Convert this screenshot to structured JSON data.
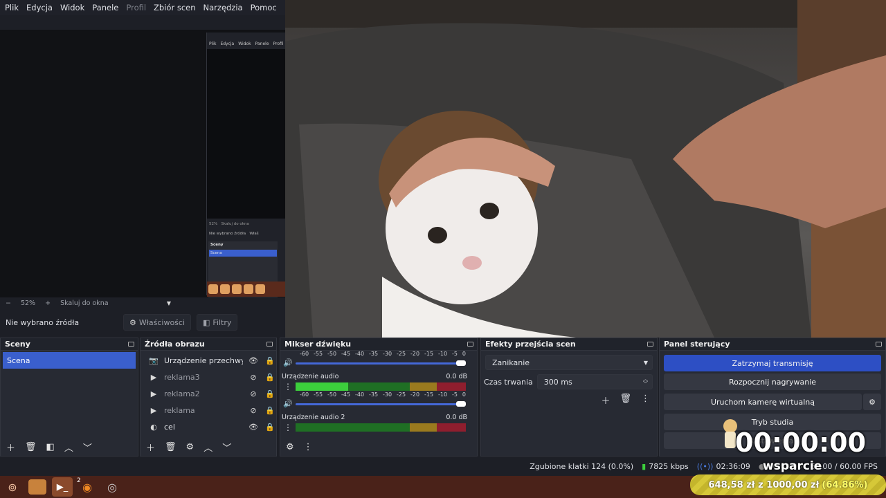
{
  "menu": [
    {
      "label": "Plik",
      "enabled": true
    },
    {
      "label": "Edycja",
      "enabled": true
    },
    {
      "label": "Widok",
      "enabled": true
    },
    {
      "label": "Panele",
      "enabled": true
    },
    {
      "label": "Profil",
      "enabled": false
    },
    {
      "label": "Zbiór scen",
      "enabled": true
    },
    {
      "label": "Narzędzia",
      "enabled": true
    },
    {
      "label": "Pomoc",
      "enabled": true
    }
  ],
  "nested_preview": {
    "menu": [
      "Plik",
      "Edycja",
      "Widok",
      "Panele",
      "Profil",
      "Zb"
    ],
    "zoom": "52%",
    "zoom_mode": "Skaluj do okna",
    "no_source": "Nie wybrano źródła",
    "props": "Właś",
    "scenes_title": "Sceny",
    "scene": "Scena"
  },
  "preview": {
    "zoom_minus": "−",
    "zoom": "52%",
    "zoom_plus": "+",
    "zoom_mode": "Skaluj do okna"
  },
  "source_bar": {
    "no_source": "Nie wybrano źródła",
    "properties": "Właściwości",
    "filters": "Filtry"
  },
  "scenes": {
    "title": "Sceny",
    "items": [
      {
        "label": "Scena",
        "selected": true
      }
    ]
  },
  "sources": {
    "title": "Źródła obrazu",
    "items": [
      {
        "label": "Urządzenie przechwytu",
        "icon": "camera-icon",
        "visible": true
      },
      {
        "label": "reklama3",
        "icon": "play-icon",
        "visible": false
      },
      {
        "label": "reklama2",
        "icon": "play-icon",
        "visible": false
      },
      {
        "label": "reklama",
        "icon": "play-icon",
        "visible": false
      },
      {
        "label": "cel",
        "icon": "globe-icon",
        "visible": true
      }
    ]
  },
  "mixer": {
    "title": "Mikser dźwięku",
    "scale": [
      "-60",
      "-55",
      "-50",
      "-45",
      "-40",
      "-35",
      "-30",
      "-25",
      "-20",
      "-15",
      "-10",
      "-5",
      "0"
    ],
    "channels": [
      {
        "name": "Urządzenie audio",
        "db": "0.0 dB",
        "level": 0.31
      },
      {
        "name": "Urządzenie audio 2",
        "db": "0.0 dB",
        "level": 0.0
      }
    ]
  },
  "transitions": {
    "title": "Efekty przejścia scen",
    "selected": "Zanikanie",
    "duration_label": "Czas trwania",
    "duration": "300 ms"
  },
  "controls": {
    "title": "Panel sterujący",
    "stop_stream": "Zatrzymaj transmisję",
    "start_record": "Rozpocznij nagrywanie",
    "virtual_cam": "Uruchom kamerę wirtualną",
    "studio_mode": "Tryb studia",
    "settings": "Ustawienia"
  },
  "status": {
    "dropped": "Zgubione klatki 124 (0.0%)",
    "bitrate": "7825 kbps",
    "stream_time": "02:36:09",
    "rec_time": "00:00:00",
    "fps": "60.00 / 60.00 FPS"
  },
  "overlay": {
    "timer": "00:00:00",
    "support": "wsparcie",
    "goal_current": "648,58 zł",
    "goal_sep": "z",
    "goal_target": "1000,00 zł",
    "goal_pct": "(64.86%)"
  },
  "taskbar": {
    "badge": "2"
  },
  "colors": {
    "accent": "#3a5fcd",
    "panel": "#272a33",
    "taskbar": "#4a2219",
    "meter_green": "#3ccf3c",
    "meter_yellow": "#9a7a1e",
    "meter_red": "#8f1e2e",
    "goal_bar": "#d6c838"
  }
}
